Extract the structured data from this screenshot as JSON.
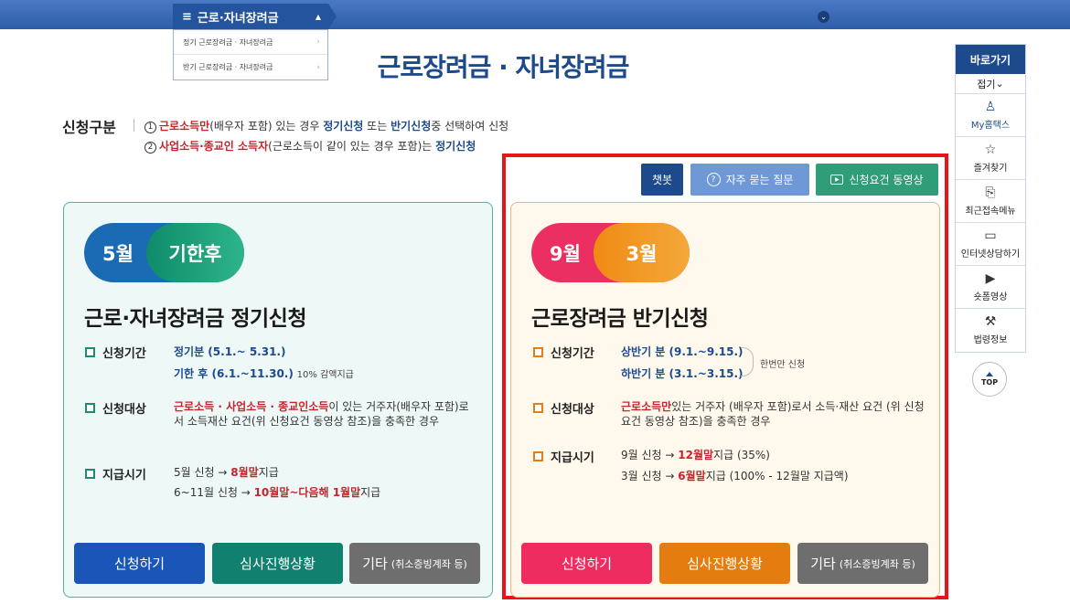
{
  "topnav": {
    "menu_label": "근로·자녀장려금",
    "menu_icon": "hamburger-icon",
    "dropdown_items": [
      "정기 근로장려금 · 자녀장려금",
      "반기 근로장려금 · 자녀장려금"
    ]
  },
  "page_title": "근로장려금 · 자녀장려금",
  "apply_type": {
    "label": "신청구분",
    "line1": {
      "num": "1",
      "red": "근로소득만",
      "t1": "(배우자 포함) 있는 경우 ",
      "blue1": "정기신청",
      "t2": " 또는 ",
      "blue2": "반기신청",
      "t3": "중 선택하여 신청"
    },
    "line2": {
      "num": "2",
      "red": "사업소득·종교인 소득자",
      "t1": "(근로소득이 같이 있는 경우 포함)는 ",
      "blue1": "정기신청"
    }
  },
  "top_buttons": {
    "chatbot": "챗봇",
    "faq": "자주 묻는 질문",
    "video": "신청요건 동영상"
  },
  "regular": {
    "pill_month": "5월",
    "pill_after": "기한후",
    "title": "근로·자녀장려금 정기신청",
    "period_label": "신청기간",
    "period1": "정기분 (5.1.~ 5.31.)",
    "period2": "기한 후 (6.1.~11.30.)",
    "period2_note": "10% 감액지급",
    "target_label": "신청대상",
    "target_red": "근로소득 · 사업소득 · 종교인소득",
    "target_text": "이 있는 거주자(배우자 포함)로서 소득재산 요건(위 신청요건 동영상 참조)을 충족한 경우",
    "pay_label": "지급시기",
    "pay1_pre": "5월 신청 → ",
    "pay1_red": "8월말",
    "pay1_post": "지급",
    "pay2_pre": "6~11월 신청 → ",
    "pay2_red": "10월말~다음해 1월말",
    "pay2_post": "지급",
    "btn_apply": "신청하기",
    "btn_status": "심사진행상황",
    "btn_etc": "기타",
    "btn_etc_sub": "(취소증빙계좌 등)",
    "colors": {
      "apply": "#1a56b8",
      "status": "#12806f",
      "etc": "#6e6e6e"
    }
  },
  "half": {
    "pill_month1": "9월",
    "pill_month2": "3월",
    "title": "근로장려금 반기신청",
    "period_label": "신청기간",
    "period1": "상반기 분 (9.1.~9.15.)",
    "period2": "하반기 분 (3.1.~3.15.)",
    "period_note": "한번만 신청",
    "target_label": "신청대상",
    "target_red": "근로소득만",
    "target_text": "있는 거주자 (배우자 포함)로서 소득·재산 요건 (위 신청요건 동영상 참조)을 충족한 경우",
    "pay_label": "지급시기",
    "pay1_pre": "9월 신청 → ",
    "pay1_red": "12월말",
    "pay1_post": "지급 (35%)",
    "pay2_pre": "3월 신청 → ",
    "pay2_red": "6월말",
    "pay2_post": "지급 (100% - 12월말 지급액)",
    "btn_apply": "신청하기",
    "btn_status": "심사진행상황",
    "btn_etc": "기타",
    "btn_etc_sub": "(취소증빙계좌 등)",
    "colors": {
      "apply": "#ef2c5f",
      "status": "#e57c0f",
      "etc": "#6e6e6e"
    }
  },
  "quick_menu": {
    "title": "바로가기",
    "fold": "접기",
    "items": [
      {
        "label": "My홈택스",
        "icon": "user-icon"
      },
      {
        "label": "즐겨찾기",
        "icon": "star-icon"
      },
      {
        "label": "최근접속메뉴",
        "icon": "recent-doc-icon"
      },
      {
        "label": "인터넷상담하기",
        "icon": "laptop-icon"
      },
      {
        "label": "숏폼영상",
        "icon": "play-icon"
      },
      {
        "label": "법령정보",
        "icon": "gavel-icon"
      }
    ],
    "top_label": "TOP"
  },
  "accent_colors": {
    "navy": "#1d4a8c",
    "red": "#c8232c",
    "highlight": "#e8141c"
  }
}
